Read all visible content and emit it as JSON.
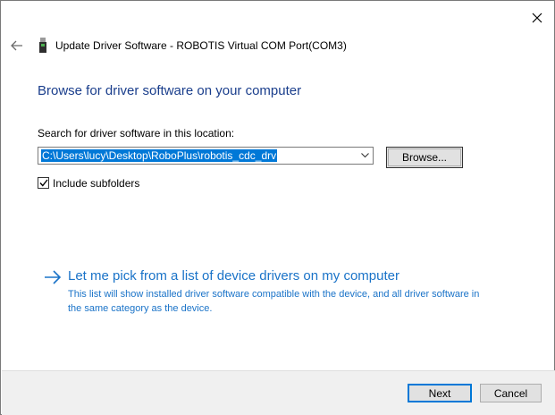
{
  "window": {
    "title": "Update Driver Software - ROBOTIS Virtual COM Port(COM3)"
  },
  "main": {
    "heading": "Browse for driver software on your computer",
    "search_label": "Search for driver software in this location:",
    "path_value": "C:\\Users\\lucy\\Desktop\\RoboPlus\\robotis_cdc_drv",
    "browse_label": "Browse...",
    "include_subfolders_label": "Include subfolders",
    "include_subfolders_checked": true
  },
  "pick": {
    "link_text": "Let me pick from a list of device drivers on my computer",
    "description": "This list will show installed driver software compatible with the device, and all driver software in the same category as the device."
  },
  "footer": {
    "next_label": "Next",
    "cancel_label": "Cancel"
  },
  "icons": {
    "close": "close-icon",
    "back": "back-arrow-icon",
    "device": "usb-device-icon",
    "dropdown": "chevron-down-icon",
    "checkmark": "checkmark-icon",
    "link_arrow": "right-arrow-icon"
  },
  "colors": {
    "heading": "#1a3e8c",
    "link": "#1a73c8",
    "selection": "#0078d7",
    "default_button_border": "#0078d7"
  }
}
